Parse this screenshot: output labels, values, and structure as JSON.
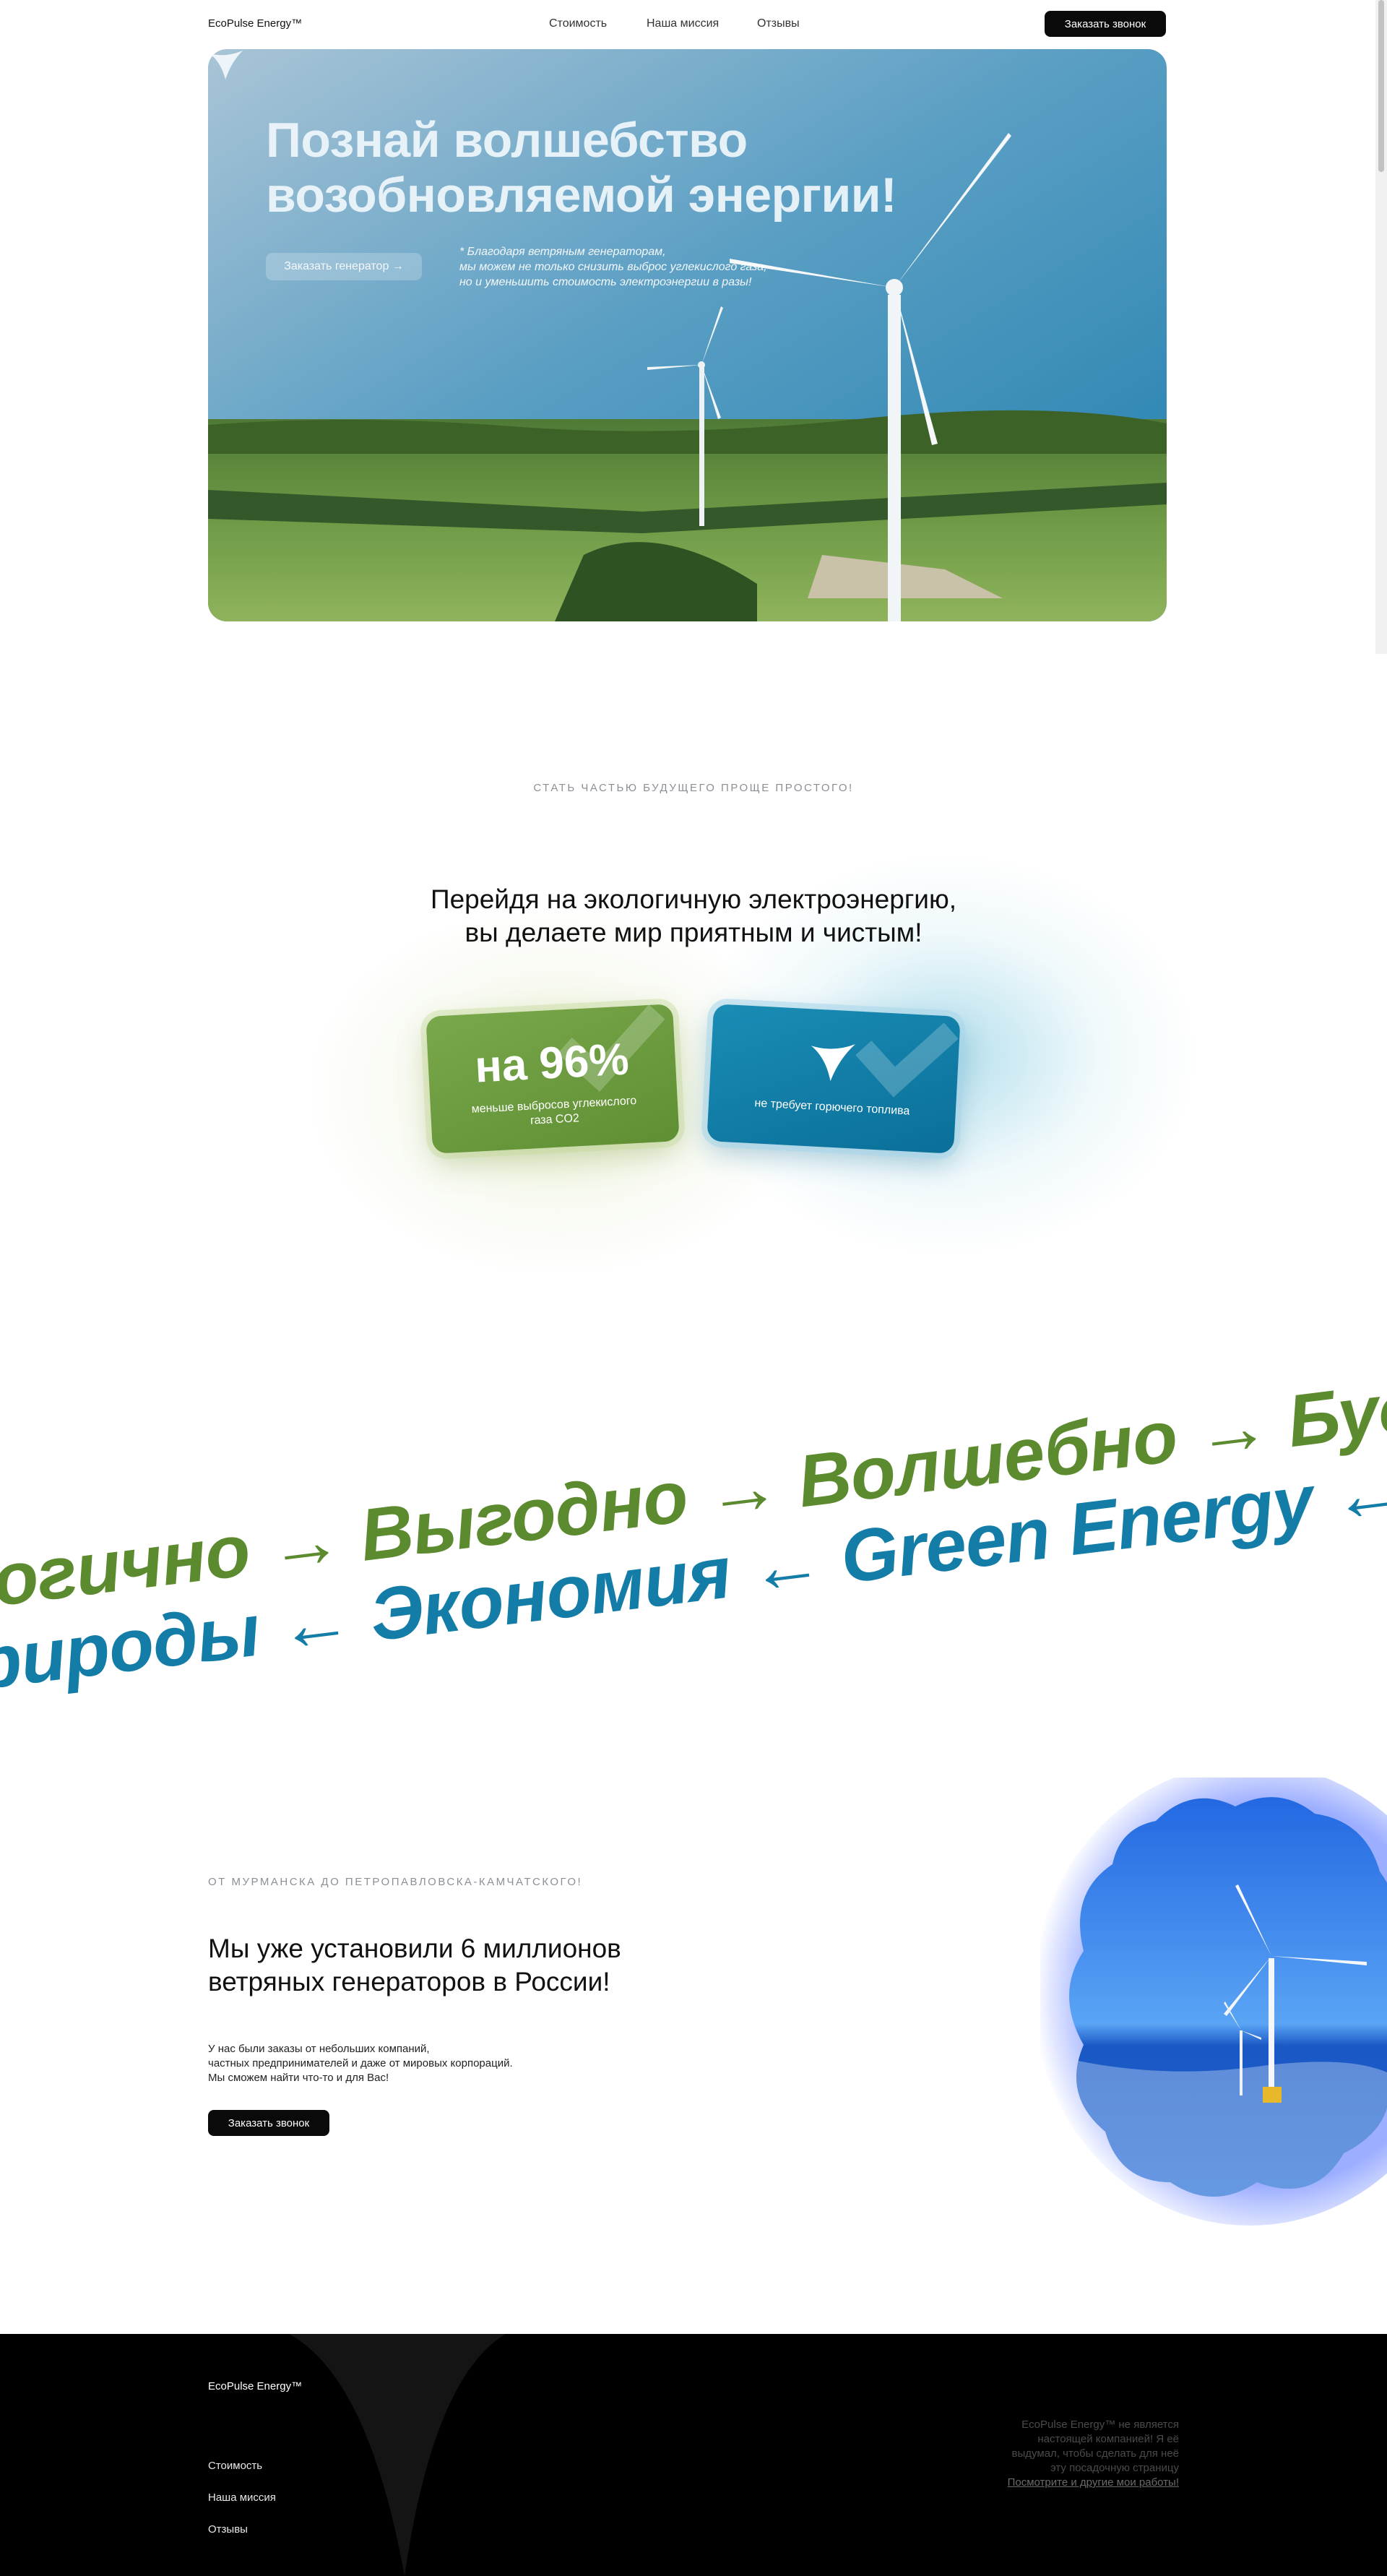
{
  "header": {
    "logo": "EcoPulse Energy™",
    "nav": [
      "Стоимость",
      "Наша миссия",
      "Отзывы"
    ],
    "cta": "Заказать звонок"
  },
  "hero": {
    "title_line1": "Познай волшебство",
    "title_line2": "возобновляемой энергии!",
    "button": "Заказать генератор →",
    "note_line1": "* Благодаря ветряным генераторам,",
    "note_line2": "мы можем не только снизить выброс углекислого газа,",
    "note_line3": "но и уменьшить стоимость электроэнергии в разы!"
  },
  "benefits": {
    "eyebrow": "СТАТЬ ЧАСТЬЮ БУДУЩЕГО ПРОЩЕ ПРОСТОГО!",
    "title_line1": "Перейдя на экологичную электроэнергию,",
    "title_line2": "вы делаете мир приятным и чистым!",
    "card_green": {
      "value": "на 96%",
      "text": "меньше выбросов углекислого газа CO2"
    },
    "card_blue": {
      "text": "не требует горючего топлива"
    }
  },
  "marquee": {
    "row1": "Экологично → Выгодно → Волшебно → Будущее → Экологично → Выгодно",
    "row2": "Для природы ← Экономия ← Green Energy ← Геотермальная ← Для природы"
  },
  "installs": {
    "eyebrow": "ОТ МУРМАНСКА ДО ПЕТРОПАВЛОВСКА-КАМЧАТСКОГО!",
    "title_line1": "Мы уже установили 6 миллионов",
    "title_line2": "ветряных генераторов в России!",
    "text_line1": "У нас были заказы от небольших компаний,",
    "text_line2": "частных предпринимателей и даже от мировых корпораций.",
    "text_line3": "Мы сможем найти что-то и для Вас!",
    "button": "Заказать звонок"
  },
  "footer": {
    "logo": "EcoPulse Energy™",
    "links": [
      "Стоимость",
      "Наша миссия",
      "Отзывы"
    ],
    "note_line1": "EcoPulse Energy™ не является",
    "note_line2": "настоящей компанией! Я её",
    "note_line3": "выдумал, чтобы сделать для неё",
    "note_line4": "эту посадочную страницу",
    "note_link": "Посмотрите и другие мои работы!"
  },
  "colors": {
    "green": "#5c8a2e",
    "blue": "#137da8",
    "dark": "#0a0a0a"
  }
}
